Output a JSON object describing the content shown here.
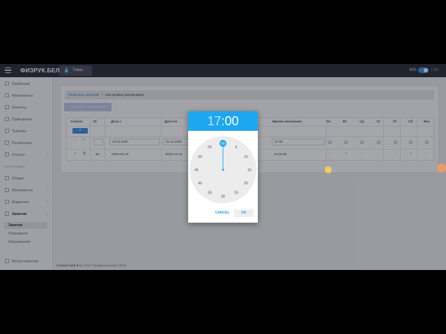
{
  "topbar": {
    "brand": "ФИЗРУК.БЕЛ",
    "themes_label": "Темы",
    "rtl": "RTL",
    "ltr": "LTR"
  },
  "sidebar": {
    "items": [
      {
        "label": "Dashboard"
      },
      {
        "label": "Абонементы"
      },
      {
        "label": "Клиенты"
      },
      {
        "label": "Помещения"
      },
      {
        "label": "Тренеры"
      },
      {
        "label": "Расписание"
      },
      {
        "label": "Отчеты"
      }
    ],
    "section_label": "НАСТРОЙКИ",
    "settings_items": [
      {
        "label": "Общие"
      },
      {
        "label": "Абонементы"
      },
      {
        "label": "Маркетинг"
      },
      {
        "label": "Занятия"
      }
    ],
    "sub_items": [
      {
        "label": "Занятия"
      },
      {
        "label": "Помещения"
      },
      {
        "label": "Направления"
      }
    ],
    "bottom_item": "Метки клиентов"
  },
  "breadcrumb": {
    "parent": "Перечень занятий",
    "separator": "/",
    "current": "Настройка расписания"
  },
  "save_button_label": "СОХРАНИТЬ ИЗМЕНЕНИЯ",
  "table": {
    "add_label": "+",
    "headers": {
      "actions": "Actions",
      "id": "ID",
      "date_from": "Дата с",
      "date_to": "Дата по",
      "end_time": "Время окончания",
      "mon": "Пн",
      "tue": "Вт",
      "wed": "Ср",
      "thu": "Чт",
      "fri": "Пт",
      "sat": "Сб",
      "sun": "Вск"
    },
    "edit_row": {
      "id_value": "",
      "date_from": "10.02.2020",
      "date_to": "31.12.2020",
      "end_time": "17:00"
    },
    "row": {
      "id": "49",
      "date_from": "2020-02-10",
      "date_to": "2020-12-31",
      "end_time": "11:00:00",
      "mon": "-",
      "tue": "+",
      "wed": "-",
      "thu": "-",
      "fri": "-",
      "sat": "+",
      "sun": "-"
    }
  },
  "footer": {
    "prefix": "Created with",
    "suffix": "by ООО \"Кредтехнологии\" 2019"
  },
  "time_picker": {
    "hours": "17",
    "colon": ":",
    "minutes": "00",
    "selected_minute": "00",
    "dial": [
      "00",
      "5",
      "10",
      "15",
      "20",
      "25",
      "30",
      "35",
      "40",
      "45",
      "50",
      "55"
    ],
    "cancel_label": "CANCEL",
    "ok_label": "OK",
    "accent_color": "#1ea7f0"
  },
  "colors": {
    "topbar_bg": "#1c1f2c",
    "primary": "#2f86e8",
    "link": "#2c8ad6"
  }
}
